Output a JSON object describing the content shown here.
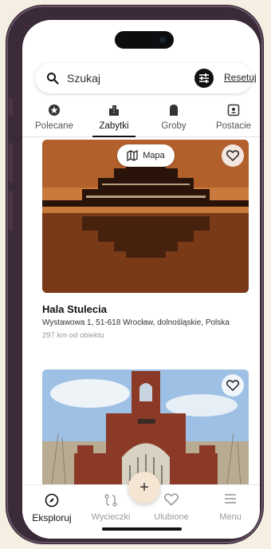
{
  "search": {
    "placeholder": "Szukaj",
    "reset_label": "Resetuj"
  },
  "tabs": [
    {
      "label": "Polecane",
      "icon": "star-badge-icon",
      "active": false
    },
    {
      "label": "Zabytki",
      "icon": "buildings-icon",
      "active": true
    },
    {
      "label": "Groby",
      "icon": "tombstone-icon",
      "active": false
    },
    {
      "label": "Postacie",
      "icon": "portrait-icon",
      "active": false
    }
  ],
  "cards": [
    {
      "map_label": "Mapa",
      "title": "Hala Stulecia",
      "address": "Wystawowa 1, 51-618 Wrocław, dolnośląskie, Polska",
      "distance": "297 km od obiektu"
    },
    {
      "image": "brick-gate-photo"
    }
  ],
  "fab_label": "+",
  "nav": [
    {
      "label": "Eksploruj",
      "icon": "compass-icon",
      "active": true
    },
    {
      "label": "Wycieczki",
      "icon": "route-icon",
      "active": false
    },
    {
      "label": "Ulubione",
      "icon": "heart-icon",
      "active": false
    },
    {
      "label": "Menu",
      "icon": "menu-icon",
      "active": false
    }
  ]
}
